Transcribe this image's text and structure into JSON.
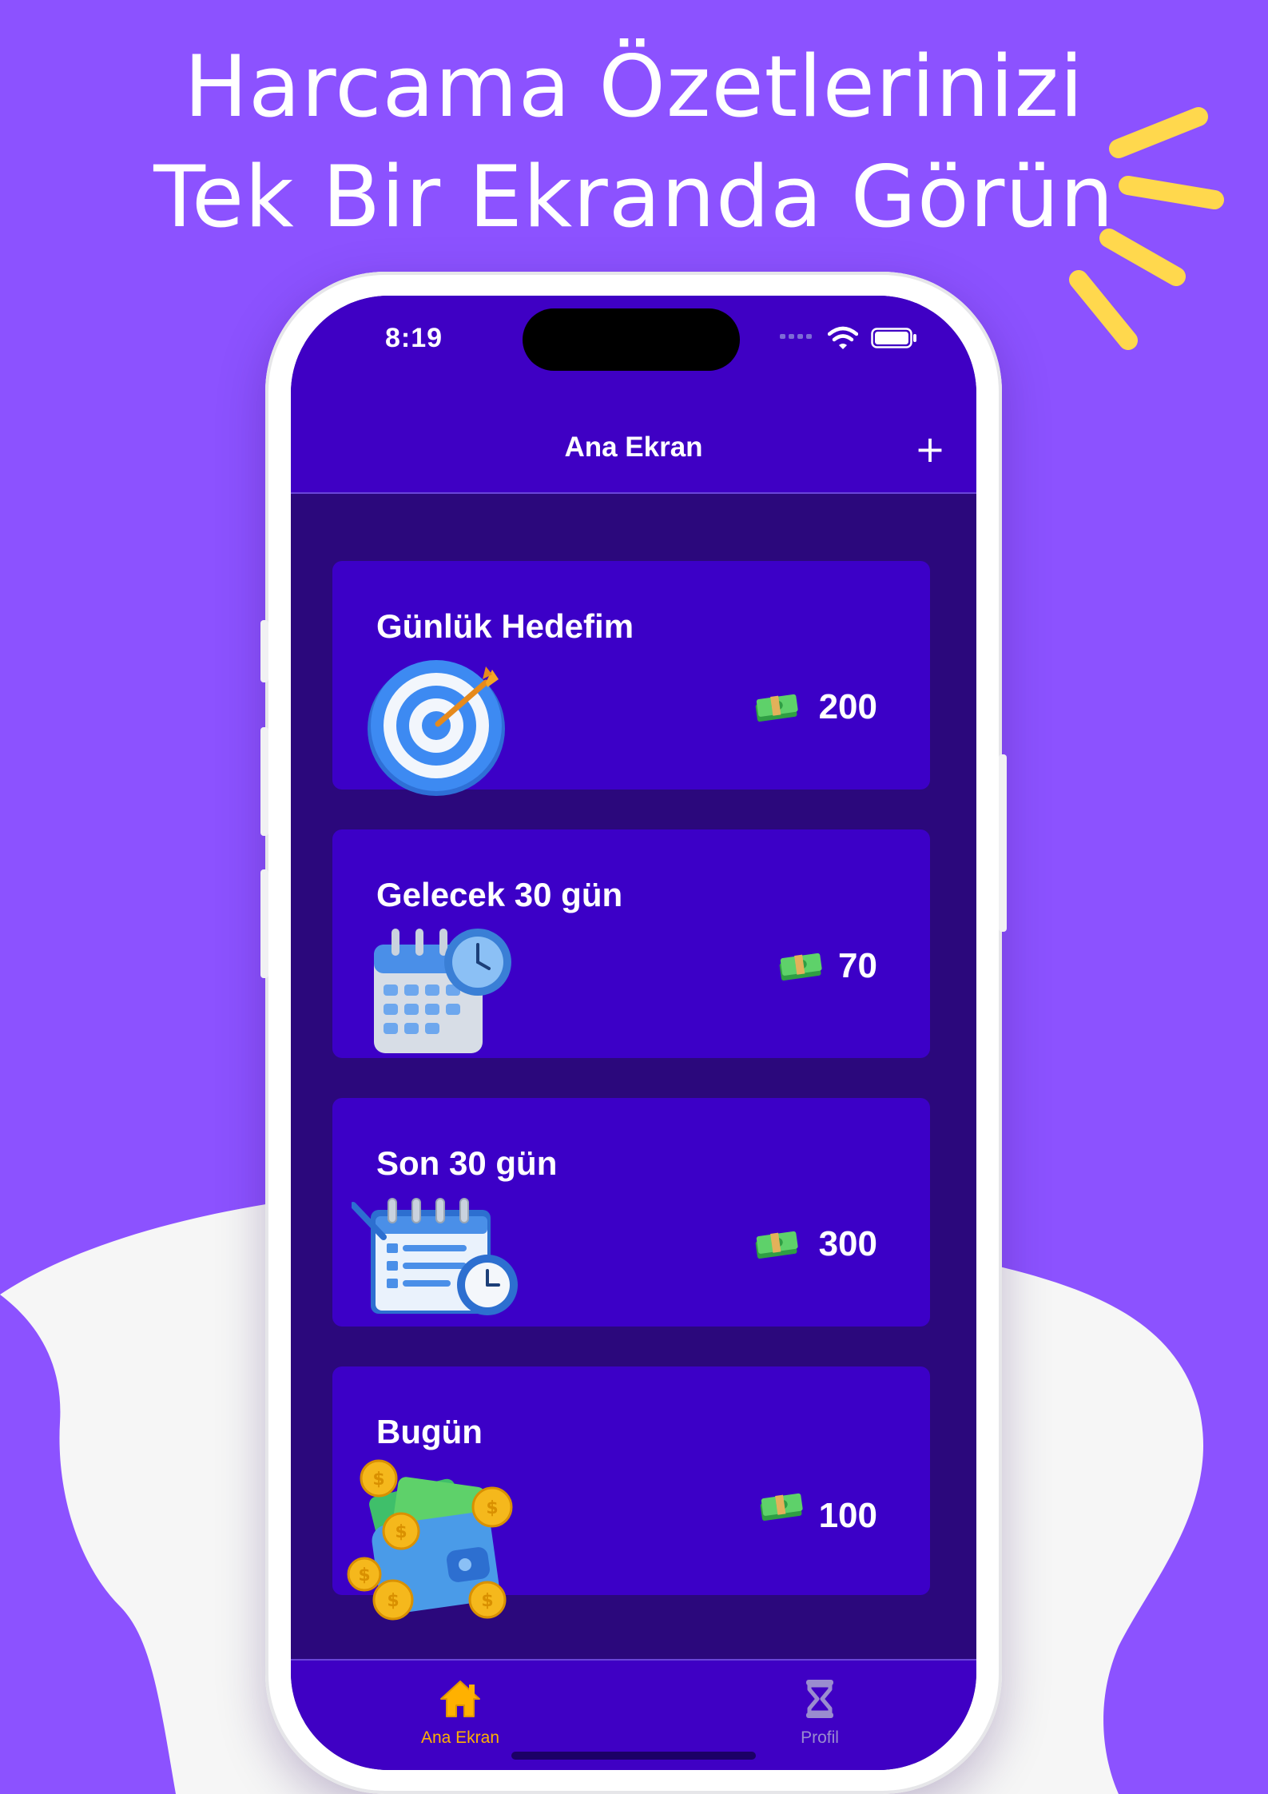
{
  "headline": {
    "line1": "Harcama Özetlerinizi",
    "line2": "Tek Bir Ekranda Görün"
  },
  "colors": {
    "background": "#8c52ff",
    "blob": "#f6f6f6",
    "accent_rays": "#ffd84d",
    "screen_bg": "#2b087c",
    "card_bg": "#3c00c7",
    "nav_bg": "#3f00c4",
    "active_tab": "#ffb100",
    "inactive_tab": "#9a8ccf"
  },
  "status_bar": {
    "time": "8:19",
    "icons": [
      "cellular-dots-icon",
      "wifi-icon",
      "battery-icon"
    ]
  },
  "nav": {
    "title": "Ana Ekran",
    "add_icon": "+"
  },
  "cards": [
    {
      "title": "Günlük Hedefim",
      "amount": "200",
      "illustration": "target-icon",
      "currency_icon": "money-icon"
    },
    {
      "title": "Gelecek 30 gün",
      "amount": "70",
      "illustration": "calendar-clock-icon",
      "currency_icon": "money-icon"
    },
    {
      "title": "Son 30 gün",
      "amount": "300",
      "illustration": "checklist-calendar-icon",
      "currency_icon": "money-icon"
    },
    {
      "title": "Bugün",
      "amount": "100",
      "illustration": "wallet-coins-icon",
      "currency_icon": "money-icon"
    }
  ],
  "tabs": [
    {
      "label": "Ana Ekran",
      "icon": "home-icon",
      "active": true
    },
    {
      "label": "Profil",
      "icon": "hourglass-icon",
      "active": false
    }
  ]
}
